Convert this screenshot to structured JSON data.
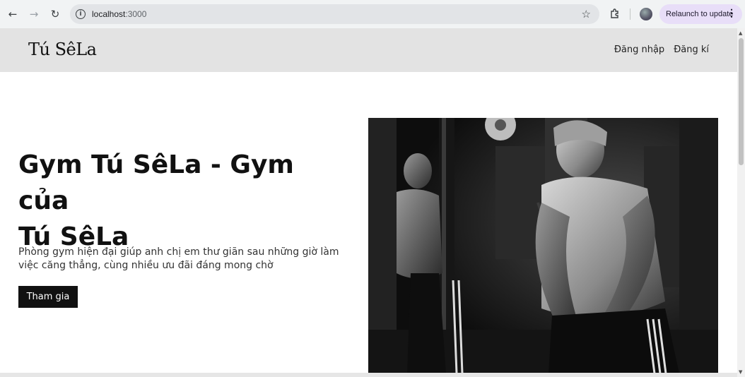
{
  "browser": {
    "url_host": "localhost",
    "url_port": ":3000",
    "relaunch_label": "Relaunch to update",
    "icons": [
      "back-icon",
      "forward-icon",
      "reload-icon",
      "info-icon",
      "star-icon",
      "extensions-icon",
      "kebab-icon"
    ]
  },
  "site": {
    "logo": "Tú SêLa",
    "nav": {
      "login": "Đăng nhập",
      "register": "Đăng kí"
    }
  },
  "hero": {
    "title_line1": "Gym Tú SêLa - Gym của",
    "title_line2": "Tú SêLa",
    "description_line1": "Phòng gym hiện đại giúp anh chị em thư giãn sau những giờ làm",
    "description_line2": "việc căng thẳng, cùng nhiều ưu đãi đáng mong chờ",
    "cta_label": "Tham gia"
  },
  "colors": {
    "header_bg": "#e3e3e3",
    "cta_bg": "#111111",
    "relaunch_bg": "#e8def8"
  }
}
